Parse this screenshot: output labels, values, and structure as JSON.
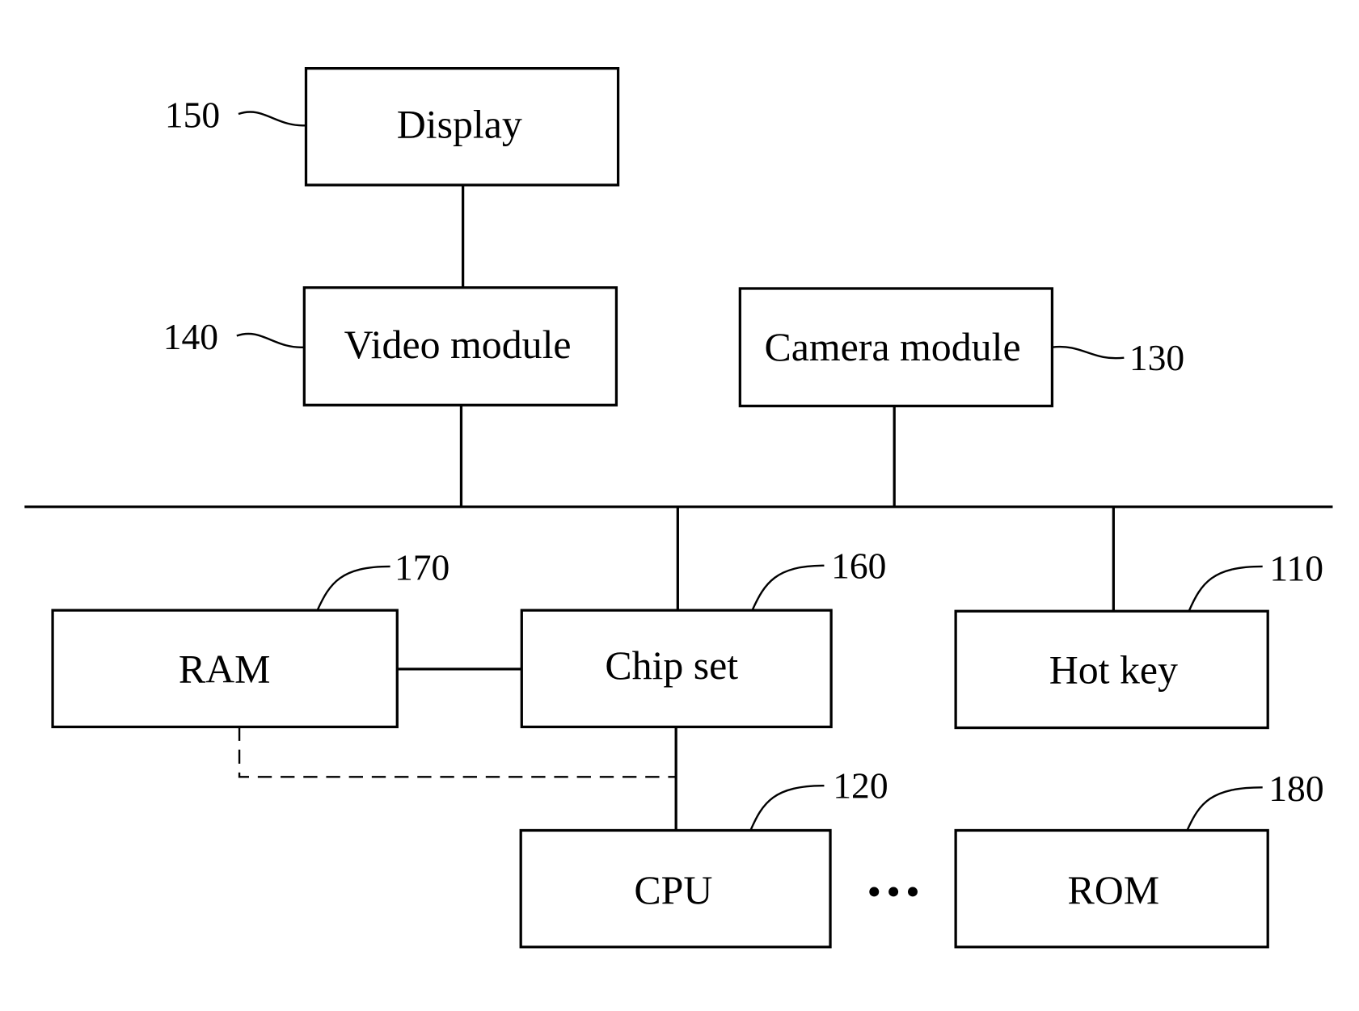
{
  "diagram": {
    "type": "block-diagram",
    "blocks": {
      "display": {
        "label": "Display",
        "ref": "150"
      },
      "video": {
        "label": "Video module",
        "ref": "140"
      },
      "camera": {
        "label": "Camera module",
        "ref": "130"
      },
      "ram": {
        "label": "RAM",
        "ref": "170"
      },
      "chipset": {
        "label": "Chip set",
        "ref": "160"
      },
      "hotkey": {
        "label": "Hot key",
        "ref": "110"
      },
      "cpu": {
        "label": "CPU",
        "ref": "120"
      },
      "rom": {
        "label": "ROM",
        "ref": "180"
      }
    },
    "connections": [
      {
        "from": "Display",
        "to": "Video module",
        "style": "solid"
      },
      {
        "from": "Video module",
        "to": "Bus",
        "style": "solid"
      },
      {
        "from": "Camera module",
        "to": "Bus",
        "style": "solid"
      },
      {
        "from": "Chip set",
        "to": "Bus",
        "style": "solid"
      },
      {
        "from": "Hot key",
        "to": "Bus",
        "style": "solid"
      },
      {
        "from": "RAM",
        "to": "Chip set",
        "style": "solid"
      },
      {
        "from": "Chip set",
        "to": "CPU",
        "style": "solid"
      },
      {
        "from": "RAM",
        "to": "CPU",
        "style": "dashed"
      }
    ],
    "ellipsis": "•••"
  }
}
